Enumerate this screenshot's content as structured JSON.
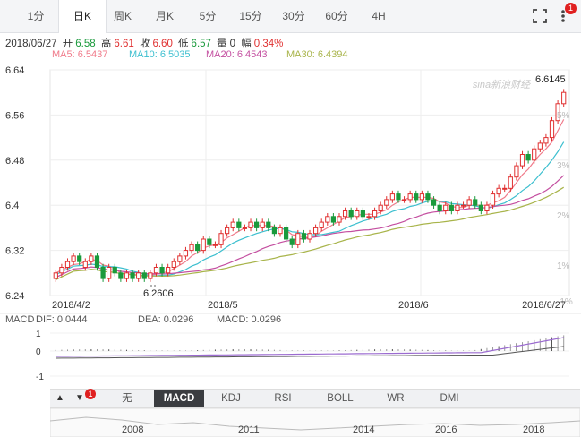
{
  "tabs": [
    "1分",
    "日K",
    "周K",
    "月K",
    "5分",
    "15分",
    "30分",
    "60分",
    "4H"
  ],
  "active_tab": 1,
  "quote": {
    "date": "2018/06/27",
    "open_label": "开",
    "open": "6.58",
    "high_label": "高",
    "high": "6.61",
    "close_label": "收",
    "close": "6.60",
    "low_label": "低",
    "low": "6.57",
    "volume_label": "量",
    "volume": "0",
    "change_label": "幅",
    "change": "0.34%"
  },
  "ma": {
    "ma5": "MA5: 6.5437",
    "ma10": "MA10: 6.5035",
    "ma20": "MA20: 6.4543",
    "ma30": "MA30: 6.4394"
  },
  "colors": {
    "up": "#e03030",
    "down": "#1a9a3c",
    "ma5": "#f07a8a",
    "ma10": "#3cbfcf",
    "ma20": "#c44fa0",
    "ma30": "#a8b44a"
  },
  "watermark": "sina新浪财经",
  "chart_data": {
    "type": "candlestick",
    "ylim": [
      6.24,
      6.64
    ],
    "y_ticks": [
      "6.64",
      "6.56",
      "6.48",
      "6.4",
      "6.32",
      "6.24"
    ],
    "right_ticks": [
      "5%",
      "3%",
      "2%",
      "1%",
      "-1%"
    ],
    "x_labels": [
      "2018/4/2",
      "2018/5",
      "2018/6",
      "2018/6/27"
    ],
    "low_marker": "6.2606",
    "high_marker": "6.6145",
    "candles": [
      [
        6.27,
        6.28
      ],
      [
        6.28,
        6.29
      ],
      [
        6.29,
        6.3
      ],
      [
        6.3,
        6.31
      ],
      [
        6.31,
        6.3
      ],
      [
        6.29,
        6.3
      ],
      [
        6.3,
        6.31
      ],
      [
        6.31,
        6.29
      ],
      [
        6.29,
        6.27
      ],
      [
        6.27,
        6.29
      ],
      [
        6.29,
        6.28
      ],
      [
        6.28,
        6.27
      ],
      [
        6.27,
        6.28
      ],
      [
        6.28,
        6.27
      ],
      [
        6.27,
        6.28
      ],
      [
        6.28,
        6.27
      ],
      [
        6.27,
        6.28
      ],
      [
        6.28,
        6.29
      ],
      [
        6.29,
        6.28
      ],
      [
        6.28,
        6.29
      ],
      [
        6.29,
        6.3
      ],
      [
        6.3,
        6.31
      ],
      [
        6.31,
        6.32
      ],
      [
        6.32,
        6.33
      ],
      [
        6.33,
        6.32
      ],
      [
        6.32,
        6.34
      ],
      [
        6.34,
        6.33
      ],
      [
        6.33,
        6.33
      ],
      [
        6.33,
        6.35
      ],
      [
        6.35,
        6.36
      ],
      [
        6.36,
        6.37
      ],
      [
        6.37,
        6.36
      ],
      [
        6.36,
        6.36
      ],
      [
        6.36,
        6.37
      ],
      [
        6.37,
        6.36
      ],
      [
        6.36,
        6.37
      ],
      [
        6.37,
        6.36
      ],
      [
        6.36,
        6.35
      ],
      [
        6.35,
        6.36
      ],
      [
        6.36,
        6.34
      ],
      [
        6.34,
        6.33
      ],
      [
        6.33,
        6.35
      ],
      [
        6.35,
        6.34
      ],
      [
        6.34,
        6.35
      ],
      [
        6.35,
        6.36
      ],
      [
        6.36,
        6.37
      ],
      [
        6.37,
        6.38
      ],
      [
        6.38,
        6.37
      ],
      [
        6.37,
        6.38
      ],
      [
        6.38,
        6.39
      ],
      [
        6.39,
        6.38
      ],
      [
        6.38,
        6.39
      ],
      [
        6.39,
        6.38
      ],
      [
        6.38,
        6.38
      ],
      [
        6.38,
        6.39
      ],
      [
        6.39,
        6.4
      ],
      [
        6.4,
        6.41
      ],
      [
        6.41,
        6.42
      ],
      [
        6.42,
        6.41
      ],
      [
        6.41,
        6.41
      ],
      [
        6.41,
        6.42
      ],
      [
        6.42,
        6.41
      ],
      [
        6.41,
        6.42
      ],
      [
        6.42,
        6.41
      ],
      [
        6.41,
        6.4
      ],
      [
        6.4,
        6.39
      ],
      [
        6.39,
        6.4
      ],
      [
        6.4,
        6.39
      ],
      [
        6.39,
        6.4
      ],
      [
        6.4,
        6.4
      ],
      [
        6.4,
        6.41
      ],
      [
        6.41,
        6.4
      ],
      [
        6.4,
        6.39
      ],
      [
        6.39,
        6.4
      ],
      [
        6.4,
        6.42
      ],
      [
        6.42,
        6.43
      ],
      [
        6.43,
        6.43
      ],
      [
        6.43,
        6.45
      ],
      [
        6.45,
        6.47
      ],
      [
        6.47,
        6.49
      ],
      [
        6.49,
        6.48
      ],
      [
        6.48,
        6.5
      ],
      [
        6.5,
        6.51
      ],
      [
        6.51,
        6.52
      ],
      [
        6.52,
        6.55
      ],
      [
        6.55,
        6.58
      ],
      [
        6.58,
        6.6
      ]
    ],
    "macd": {
      "label": "MACD",
      "dif": "DIF: 0.0444",
      "dea": "DEA: 0.0296",
      "macd": "MACD: 0.0296",
      "y_ticks": [
        "1",
        "0",
        "-1"
      ]
    }
  },
  "indicator_tabs": [
    "无",
    "MACD",
    "KDJ",
    "RSI",
    "BOLL",
    "WR",
    "DMI"
  ],
  "active_indicator": 1,
  "nav_years": [
    "2008",
    "2011",
    "2014",
    "2016",
    "2018"
  ],
  "badges": {
    "top": "1",
    "bottom": "1"
  }
}
